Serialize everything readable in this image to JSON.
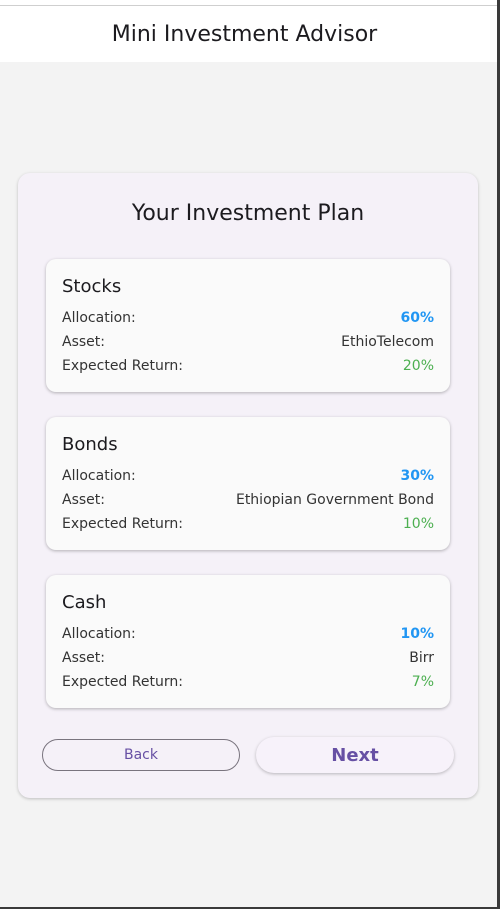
{
  "app_bar": {
    "title": "Mini Investment Advisor"
  },
  "plan": {
    "title": "Your Investment Plan",
    "assets": [
      {
        "name": "Stocks",
        "allocation_label": "Allocation:",
        "allocation": "60%",
        "asset_label": "Asset:",
        "asset": "EthioTelecom",
        "return_label": "Expected Return:",
        "return": "20%"
      },
      {
        "name": "Bonds",
        "allocation_label": "Allocation:",
        "allocation": "30%",
        "asset_label": "Asset:",
        "asset": "Ethiopian Government Bond",
        "return_label": "Expected Return:",
        "return": "10%"
      },
      {
        "name": "Cash",
        "allocation_label": "Allocation:",
        "allocation": "10%",
        "asset_label": "Asset:",
        "asset": "Birr",
        "return_label": "Expected Return:",
        "return": "7%"
      }
    ]
  },
  "actions": {
    "back_label": "Back",
    "next_label": "Next"
  },
  "colors": {
    "allocation": "#2196f3",
    "return": "#4caf50",
    "primary": "#6750a4",
    "card_background": "#f5f1f8"
  }
}
